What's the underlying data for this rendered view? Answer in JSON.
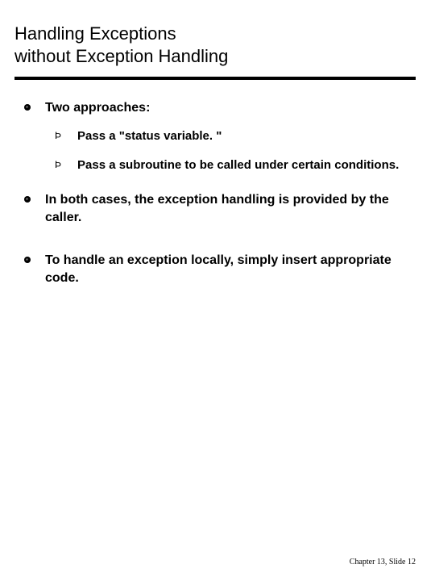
{
  "title_line1": "Handling Exceptions",
  "title_line2": "without Exception Handling",
  "bullets": [
    {
      "text": "Two approaches:",
      "sub": [
        "Pass a \"status variable. \"",
        "Pass a subroutine to be called under certain conditions."
      ]
    },
    {
      "text": "In both cases, the exception handling is provided by the caller.",
      "sub": []
    },
    {
      "text": "To handle an exception locally, simply insert appropriate code.",
      "sub": []
    }
  ],
  "sub_bullet_glyph": "Þ",
  "footer": "Chapter 13, Slide  12"
}
